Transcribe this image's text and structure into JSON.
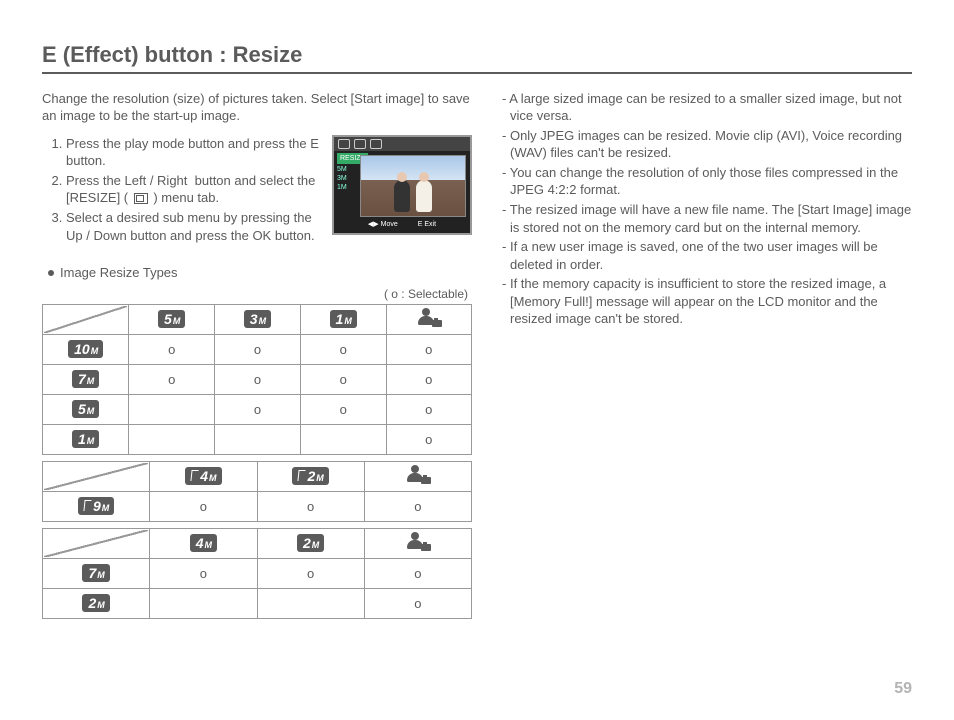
{
  "title": "E (Effect) button : Resize",
  "intro": "Change the resolution (size) of pictures taken. Select [Start image] to save an image to be the start-up image.",
  "steps": [
    "Press the play mode button and press the E button.",
    "Press the Left / Right  button and select the [RESIZE] (       ) menu tab.",
    "Select a desired sub menu by pressing the Up / Down button and press the OK button."
  ],
  "lcd": {
    "label": "RESIZE",
    "side": [
      "5M",
      "3M",
      "1M",
      ""
    ],
    "move": "Move",
    "exit_key": "E",
    "exit": "Exit"
  },
  "resize_label": "Image Resize Types",
  "selectable_note": "( o : Selectable)",
  "tables": [
    {
      "cols": [
        "5M",
        "3M",
        "1M",
        "USER"
      ],
      "rows": [
        {
          "head": "10M",
          "cells": [
            "o",
            "o",
            "o",
            "o"
          ]
        },
        {
          "head": "7M",
          "cells": [
            "o",
            "o",
            "o",
            "o"
          ]
        },
        {
          "head": "5M",
          "cells": [
            "",
            "o",
            "o",
            "o"
          ]
        },
        {
          "head": "1M",
          "cells": [
            "",
            "",
            "",
            "o"
          ]
        }
      ]
    },
    {
      "cols": [
        "4M_w",
        "2M_w",
        "USER"
      ],
      "rows": [
        {
          "head": "9M_w",
          "cells": [
            "o",
            "o",
            "o"
          ]
        }
      ]
    },
    {
      "cols": [
        "4M",
        "2M",
        "USER"
      ],
      "rows": [
        {
          "head": "7M",
          "cells": [
            "o",
            "o",
            "o"
          ]
        },
        {
          "head": "2M",
          "cells": [
            "",
            "",
            "o"
          ]
        }
      ]
    }
  ],
  "notes": [
    "A large sized image can be resized to a smaller sized image, but not vice versa.",
    "Only JPEG images can be resized. Movie clip (AVI), Voice recording (WAV) files can't be resized.",
    "You can change the resolution of only those files compressed in the JPEG 4:2:2 format.",
    " The resized image will have a new file name. The [Start Image] image is stored not on the memory card but on the internal memory.",
    "If a new user image is saved, one of the two user images will be deleted in order.",
    "If the memory capacity is insufficient to store the resized image, a [Memory Full!] message will appear on the LCD monitor and the resized image can't be stored."
  ],
  "page_number": "59"
}
